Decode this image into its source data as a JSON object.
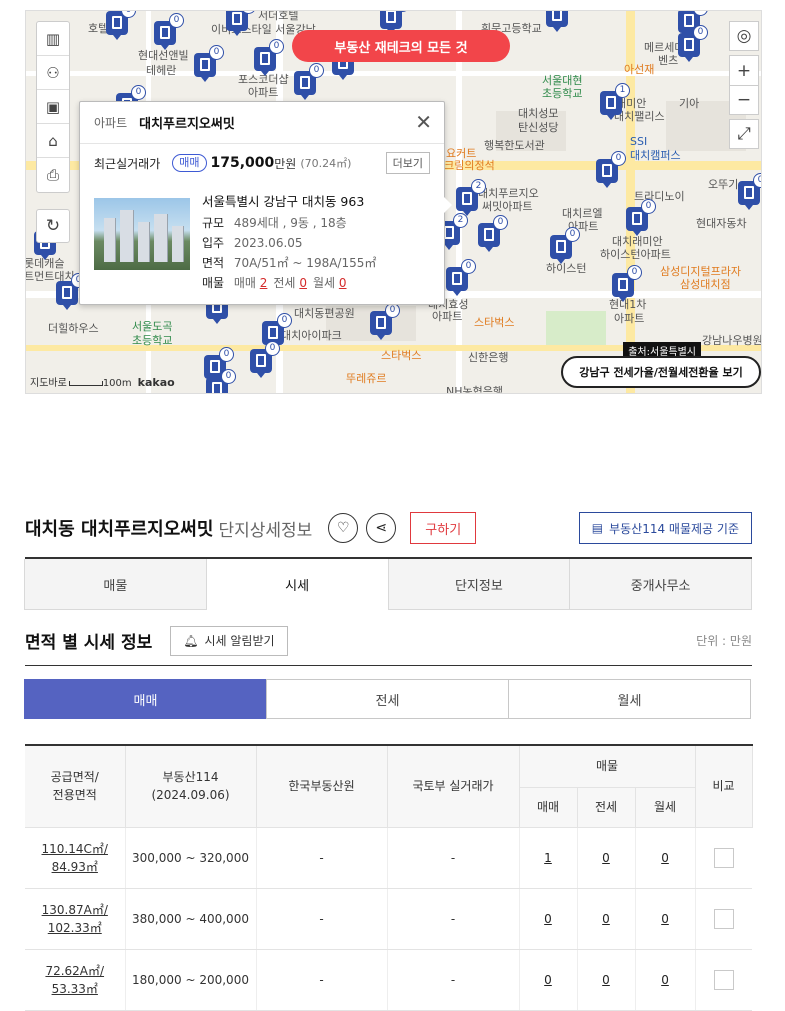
{
  "map": {
    "promo_banner": "부동산 재테크의 모든 것",
    "source_badge": "출처:서울특별시",
    "seoul_button": "강남구 전세가율/전월세전환율 보기",
    "scale_label": "100m",
    "map_logo": "kakao",
    "scale_prefix": "지도바로",
    "labels": [
      "서더호텔",
      "이비스스타일 서울강남",
      "휘문고등학교",
      "호텔",
      "현대아파트",
      "현대선앤빌",
      "테헤란",
      "포스코더샵",
      "아파트",
      "서울대현",
      "초등학교",
      "아선재",
      "메르세데스",
      "벤츠",
      "기아",
      "대치성모",
      "탄신성당",
      "행복한도서관",
      "요커트",
      "스크림의정석",
      "SSI",
      "대치캠퍼스",
      "래미안",
      "대치팰리스",
      "오뚜기",
      "트라디노이",
      "현대자동차",
      "대치푸르지오",
      "써밋아파트",
      "대치르엘",
      "아파트",
      "대치래미안",
      "하이스턴아파트",
      "래미안",
      "하이스턴",
      "삼성디지털프라자",
      "삼성대치점",
      "현대1차",
      "아파트",
      "대치효성",
      "아파트",
      "스타벅스",
      "대치동편공원",
      "서울도곡",
      "초등학교",
      "더힐하우스",
      "스타벅스",
      "신한은행",
      "뚜레쥬르",
      "NH농협은행",
      "강남나우병원",
      "롯데캐슬",
      "트먼트대치",
      "대치아이파크"
    ],
    "markers": [
      "0",
      "0",
      "0",
      "0",
      "0",
      "0",
      "0",
      "0",
      "0",
      "0",
      "1",
      "0",
      "0",
      "0",
      "0",
      "0",
      "2",
      "2",
      "0",
      "0",
      "0",
      "0",
      "0",
      "0",
      "0",
      "0",
      "0",
      "0",
      "0",
      "0",
      "0",
      "0",
      "0",
      "0",
      "0"
    ]
  },
  "popup": {
    "type_label": "아파트",
    "name": "대치푸르지오써밋",
    "recent_label": "최근실거래가",
    "deal_pill": "매매",
    "price": "175,000",
    "price_unit": "만원",
    "price_area": "(70.24㎡)",
    "more_btn": "더보기",
    "address": "서울특별시 강남구 대치동 963",
    "rows": [
      {
        "key": "규모",
        "value": "489세대 , 9동 , 18층"
      },
      {
        "key": "입주",
        "value": "2023.06.05"
      },
      {
        "key": "면적",
        "value": "70A/51㎡ ~ 198A/155㎡"
      }
    ],
    "listings_key": "매물",
    "listings": [
      {
        "label": "매매",
        "count": "2"
      },
      {
        "label": "전세",
        "count": "0"
      },
      {
        "label": "월세",
        "count": "0"
      }
    ]
  },
  "detail": {
    "title": "대치동 대치푸르지오써밋",
    "subtitle": "단지상세정보",
    "buy_button": "구하기",
    "source_button": "부동산114 매물제공 기준",
    "tabs": [
      "매물",
      "시세",
      "단지정보",
      "중개사무소"
    ],
    "active_tab": "시세",
    "section_title": "면적 별 시세 정보",
    "alert_button": "시세 알림받기",
    "unit_label": "단위 : 만원",
    "deal_tabs": [
      "매매",
      "전세",
      "월세"
    ],
    "active_deal_tab": "매매"
  },
  "table": {
    "headers": {
      "area": [
        "공급면적/",
        "전용면적"
      ],
      "r114": [
        "부동산114",
        "(2024.09.06)"
      ],
      "kab": "한국부동산원",
      "molit": "국토부 실거래가",
      "listings": "매물",
      "sub": [
        "매매",
        "전세",
        "월세"
      ],
      "compare": "비교"
    },
    "rows": [
      {
        "supply": "110.14C㎡/",
        "exclusive": "84.93㎡",
        "price": "300,000 ~ 320,000",
        "kab": "-",
        "molit": "-",
        "sale": "1",
        "jeonse": "0",
        "monthly": "0"
      },
      {
        "supply": "130.87A㎡/",
        "exclusive": "102.33㎡",
        "price": "380,000 ~ 400,000",
        "kab": "-",
        "molit": "-",
        "sale": "0",
        "jeonse": "0",
        "monthly": "0"
      },
      {
        "supply": "72.62A㎡/",
        "exclusive": "53.33㎡",
        "price": "180,000 ~ 200,000",
        "kab": "-",
        "molit": "-",
        "sale": "0",
        "jeonse": "0",
        "monthly": "0"
      }
    ]
  },
  "colors": {
    "accent": "#5563c1",
    "promo": "#f2454a",
    "marker": "#2f4fa8",
    "red": "#e0393e"
  }
}
